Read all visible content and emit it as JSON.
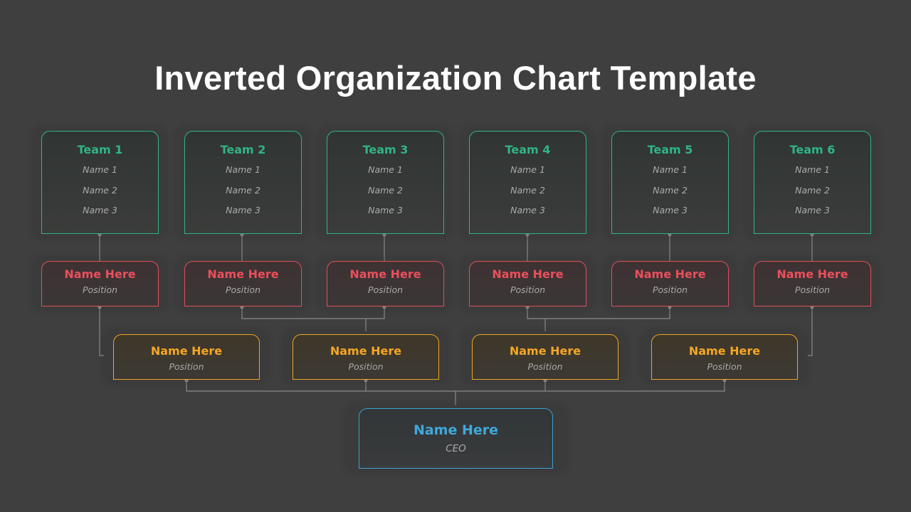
{
  "title": "Inverted Organization Chart Template",
  "colors": {
    "background": "#3f3f3f",
    "team": "#2fb585",
    "manager": "#ea4f5c",
    "director": "#f5a623",
    "ceo": "#3fa9dc",
    "connector": "#8a8a8a"
  },
  "teams": [
    {
      "label": "Team 1",
      "members": [
        "Name 1",
        "Name 2",
        "Name 3"
      ]
    },
    {
      "label": "Team 2",
      "members": [
        "Name 1",
        "Name 2",
        "Name 3"
      ]
    },
    {
      "label": "Team 3",
      "members": [
        "Name 1",
        "Name 2",
        "Name 3"
      ]
    },
    {
      "label": "Team 4",
      "members": [
        "Name 1",
        "Name 2",
        "Name 3"
      ]
    },
    {
      "label": "Team 5",
      "members": [
        "Name 1",
        "Name 2",
        "Name 3"
      ]
    },
    {
      "label": "Team 6",
      "members": [
        "Name 1",
        "Name 2",
        "Name 3"
      ]
    }
  ],
  "managers": [
    {
      "name": "Name Here",
      "position": "Position"
    },
    {
      "name": "Name Here",
      "position": "Position"
    },
    {
      "name": "Name Here",
      "position": "Position"
    },
    {
      "name": "Name Here",
      "position": "Position"
    },
    {
      "name": "Name Here",
      "position": "Position"
    },
    {
      "name": "Name Here",
      "position": "Position"
    }
  ],
  "directors": [
    {
      "name": "Name Here",
      "position": "Position"
    },
    {
      "name": "Name Here",
      "position": "Position"
    },
    {
      "name": "Name Here",
      "position": "Position"
    },
    {
      "name": "Name Here",
      "position": "Position"
    }
  ],
  "ceo": {
    "name": "Name Here",
    "position": "CEO"
  },
  "hierarchy": {
    "team_to_manager": [
      [
        0,
        0
      ],
      [
        1,
        1
      ],
      [
        2,
        2
      ],
      [
        3,
        3
      ],
      [
        4,
        4
      ],
      [
        5,
        5
      ]
    ],
    "manager_to_director": [
      [
        0,
        0
      ],
      [
        1,
        1
      ],
      [
        2,
        1
      ],
      [
        3,
        2
      ],
      [
        4,
        2
      ],
      [
        5,
        3
      ]
    ],
    "director_to_ceo": [
      0,
      1,
      2,
      3
    ]
  }
}
